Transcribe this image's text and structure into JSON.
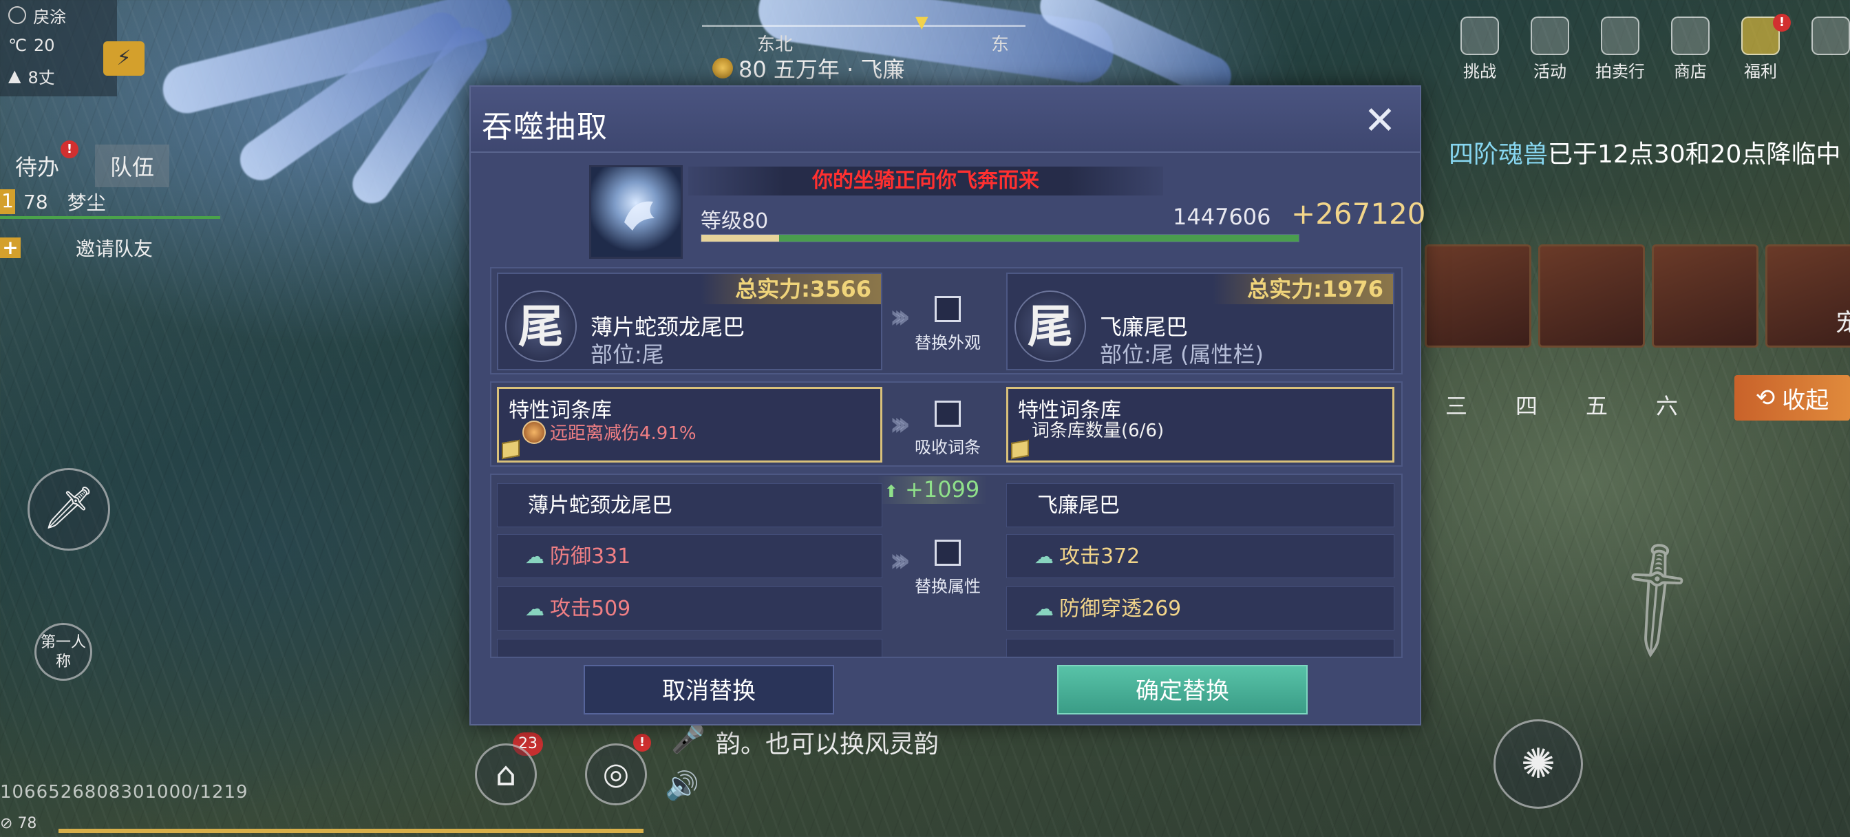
{
  "hud": {
    "weather_label": "戾涂",
    "temperature": "20",
    "wind": "8丈",
    "tabs": [
      "待办",
      "队伍"
    ],
    "team_member": {
      "index": "1",
      "level": "78",
      "name": "梦尘"
    },
    "invite": "邀请队友",
    "first_person": "第一人称"
  },
  "compass": {
    "labels": [
      "东北",
      "东"
    ],
    "location": "80 五万年 · 飞廉"
  },
  "top_menu": [
    {
      "label": "挑战"
    },
    {
      "label": "活动"
    },
    {
      "label": "拍卖行"
    },
    {
      "label": "商店"
    },
    {
      "label": "福利"
    }
  ],
  "announce": {
    "highlight": "四阶魂兽",
    "text": "已于12点30和20点降临中"
  },
  "slot_glyph": "宠",
  "slot_numbers": [
    "三",
    "四",
    "五",
    "六"
  ],
  "collapse_label": "收起",
  "chat_text": "韵。也可以换风灵韵",
  "badge_count": "23",
  "uid_text": "1066526808301000/1219",
  "player_level": "78",
  "dialog": {
    "title": "吞噬抽取",
    "alert": "你的坐骑正向你飞奔而来",
    "mount_level": "等级80",
    "mount_exp": "1447606",
    "mount_gain": "+267120",
    "mount_progress": 0.13,
    "left_item": {
      "power": "总实力:3566",
      "icon_char": "尾",
      "name": "薄片蛇颈龙尾巴",
      "part": "部位:尾"
    },
    "right_item": {
      "power": "总实力:1976",
      "icon_char": "尾",
      "name": "飞廉尾巴",
      "part": "部位:尾 (属性栏)"
    },
    "replace_appearance": "替换外观",
    "left_lib": {
      "title": "特性词条库",
      "line": "远距离减伤4.91%"
    },
    "right_lib": {
      "title": "特性词条库",
      "line": "词条库数量(6/6)"
    },
    "absorb_label": "吸收词条",
    "power_gain": "+1099",
    "left_attrs": {
      "name": "薄片蛇颈龙尾巴",
      "values": [
        "防御331",
        "攻击509"
      ]
    },
    "right_attrs": {
      "name": "飞廉尾巴",
      "values": [
        "攻击372",
        "防御穿透269"
      ]
    },
    "replace_attrs": "替换属性",
    "cancel": "取消替换",
    "confirm": "确定替换"
  },
  "colors": {
    "dialog_bg": "#3f4870",
    "alert": "#ff3030",
    "power": "#f0d47a",
    "confirm": "#4fb39b",
    "gain_green": "#8fe08a"
  }
}
